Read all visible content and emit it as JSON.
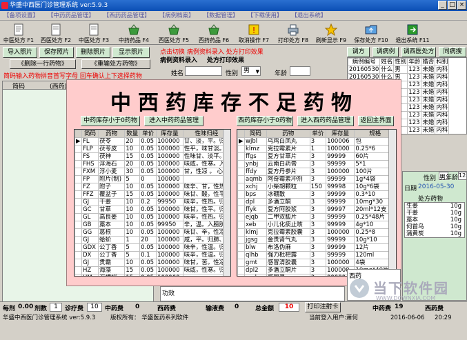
{
  "window": {
    "title": "华盛中西医门诊管理系统 ver:5.9.3"
  },
  "menu": [
    "【备项设置】",
    "【中药药品管理】",
    "【西药药品管理】",
    "【病例档案】",
    "【数据管理】",
    "【下载使用】",
    "【退出系统】"
  ],
  "toolbar": [
    {
      "label": "中医处方 F1",
      "icon": "document-icon"
    },
    {
      "label": "西医处方 F2",
      "icon": "document-icon"
    },
    {
      "label": "中医处方 F3",
      "icon": "document-icon"
    },
    {
      "label": "中药药品 F4",
      "icon": "basket-icon"
    },
    {
      "label": "西医处方 F5",
      "icon": "basket-icon"
    },
    {
      "label": "西药药品 F6",
      "icon": "basket-icon"
    },
    {
      "label": "取消操作 F7",
      "icon": "alert-icon"
    },
    {
      "label": "打印处方 F8",
      "icon": "printer-icon"
    },
    {
      "label": "刷新显示 F9",
      "icon": "star-icon"
    },
    {
      "label": "保存处方 F10",
      "icon": "folder-icon"
    },
    {
      "label": "退出系统 F11",
      "icon": "exit-icon"
    }
  ],
  "left_tabs": [
    "导入照片",
    "保存照片",
    "删除照片",
    "显示照片"
  ],
  "left_buttons": {
    "delete_row": "《删除一行药物》",
    "reimport": "《重输处方药物》"
  },
  "left_hint": "简码输入药物拼音首写字母  回车确认上下选择药物",
  "left_grid_headers": [
    "简码",
    "(西药)"
  ],
  "red_banner": "点击切换 病例资料录入 处方打印效果",
  "mid_tabs": [
    "病例资料录入",
    "处方打印效果"
  ],
  "form": {
    "name_label": "姓名",
    "name_value": "",
    "gender_label": "性别",
    "gender_value": "男",
    "age_label": "年龄",
    "age_value": ""
  },
  "right_tabs": [
    "调方",
    "调病例",
    "调西医处方",
    "同病搜"
  ],
  "right_table": {
    "headers": [
      "病例编号",
      "姓名",
      "性别",
      "年龄",
      "婚否",
      "家",
      "科别"
    ],
    "rows": [
      [
        "20160530",
        "什么",
        "男",
        "123",
        "未婚",
        "内科"
      ],
      [
        "20160530",
        "什么",
        "男",
        "123",
        "未婚",
        "内科"
      ],
      [
        "20160530",
        "什么",
        "男",
        "123",
        "未婚",
        "内科"
      ],
      [
        "20160530",
        "什么",
        "男",
        "123",
        "未婚",
        "内科"
      ],
      [
        "20160530",
        "什么",
        "男",
        "123",
        "未婚",
        "内科"
      ],
      [
        "20160530",
        "什么",
        "男",
        "123",
        "未婚",
        "内科"
      ],
      [
        "20160530",
        "什么",
        "男",
        "123",
        "未婚",
        "内科"
      ],
      [
        "20160530",
        "什么",
        "男",
        "123",
        "未婚",
        "内科"
      ],
      [
        "20160530",
        "什么",
        "男",
        "123",
        "未婚",
        "内科"
      ]
    ]
  },
  "overlay": {
    "title": "中西药库存不足药物",
    "left_btn1": "中药库存小于0药物",
    "left_btn2": "进入中药药品管理",
    "right_btn1": "西药库存小于0药物",
    "right_btn2": "进入西药药品管理",
    "right_btn3": "返回主界面",
    "left_headers": [
      "简码",
      "药物",
      "数量",
      "单价",
      "库存量",
      "性味归经"
    ],
    "left_rows": [
      [
        "FL",
        "茯苓",
        "20",
        "0.05",
        "100000",
        "甘、淡，平。归"
      ],
      [
        "FLP",
        "茯苓皮",
        "10",
        "0.05",
        "100000",
        "性平，味甘淡。"
      ],
      [
        "FS",
        "茯神",
        "15",
        "0.05",
        "100000",
        "性味甘、淡平。"
      ],
      [
        "FHS",
        "浮海石",
        "20",
        "0.05",
        "100000",
        "味咸，性寒。入"
      ],
      [
        "FXM",
        "浮小麦",
        "30",
        "0.05",
        "100000",
        "甘，性凉 。 心"
      ],
      [
        "FP",
        "附片(制)",
        "5",
        "0",
        "100000",
        ""
      ],
      [
        "FZ",
        "附子",
        "10",
        "0.05",
        "100000",
        "味辛、甘，性热"
      ],
      [
        "FFZ",
        "覆盆子",
        "15",
        "0.05",
        "100000",
        "味甘、酸，性平"
      ],
      [
        "GJ",
        "干姜",
        "10",
        "0.2",
        "99950",
        "味辛，性热。归"
      ],
      [
        "GC",
        "甘草",
        "10",
        "0.05",
        "100000",
        "味甘，性平。归"
      ],
      [
        "GL",
        "高良姜",
        "10",
        "0.05",
        "100000",
        "味辛，性热。归"
      ],
      [
        "GB",
        "藁本",
        "10",
        "0.05",
        "99950",
        "辛，温。入膀胱"
      ],
      [
        "GG",
        "葛根",
        "10",
        "0.05",
        "100000",
        "味甘、辛，性凉"
      ],
      [
        "GJ",
        "蛤蚧",
        "1",
        "20",
        "100000",
        "咸，平。归肺、"
      ],
      [
        "GDX",
        "公丁香",
        "5",
        "0.05",
        "100000",
        "味辛，性温。归"
      ],
      [
        "DX",
        "公丁香",
        "5",
        "0.1",
        "100000",
        "味辛，性温。归"
      ],
      [
        "GJ",
        "贯霸",
        "10",
        "0.05",
        "100000",
        "味甘，苦。性凉"
      ],
      [
        "HZ",
        "海藻",
        "15",
        "0.05",
        "100000",
        "味咸，性寒。归"
      ],
      [
        "HM",
        "海螵蛸",
        "15",
        "0.05",
        "100000",
        ""
      ]
    ],
    "right_headers": [
      "简码",
      "药物",
      "单价",
      "库存量",
      "规格"
    ],
    "right_rows": [
      [
        "wjbl",
        "乌鸡白凤丸",
        "3",
        "100006",
        "包"
      ],
      [
        "klmz",
        "克拉霉素片",
        "1",
        "100000",
        "0.25*6"
      ],
      [
        "ffgs",
        "复方甘草片",
        "3",
        "99999",
        "60片"
      ],
      [
        "ynbj",
        "云南白药膏",
        "3",
        "99999",
        "5*1"
      ],
      [
        "ffdy",
        "复方丹参片",
        "3",
        "100000",
        "100片"
      ],
      [
        "aqmb",
        "阿奇霉素冲剂",
        "3",
        "99999",
        "1g*4袋"
      ],
      [
        "xchj",
        "小柴胡颗粒",
        "150",
        "99998",
        "10g*6袋"
      ],
      [
        "bps",
        "冰硼散",
        "3",
        "99999",
        "0.3*10"
      ],
      [
        "dpl",
        "多潘立酮",
        "3",
        "99999",
        "10mg*30"
      ],
      [
        "ffyk",
        "复方阿胶浆",
        "3",
        "99997",
        "20ml*12支"
      ],
      [
        "ejqb",
        "二甲双胍片",
        "3",
        "99999",
        "0.25*48片"
      ],
      [
        "xeb",
        "小儿化痰止咳",
        "3",
        "99999",
        "4g*10"
      ],
      [
        "klmj",
        "克拉霉素胶囊",
        "3",
        "100000",
        "0.25*8"
      ],
      [
        "jgsg",
        "金贵肾气丸",
        "3",
        "99999",
        "10g*10"
      ],
      [
        "blw",
        "布洛伪麻",
        "3",
        "99999",
        "12片"
      ],
      [
        "qlhb",
        "强力枇杷露",
        "3",
        "99999",
        "120ml"
      ],
      [
        "gmt",
        "感冒清胶囊",
        "3",
        "100000",
        "4袋"
      ],
      [
        "dpl2",
        "多潘立酮片",
        "3",
        "100000",
        "10mg*40片"
      ],
      [
        "gml",
        "感冒灵",
        "3",
        "99999",
        "10g*9袋"
      ]
    ]
  },
  "right_lower": {
    "gender_label": "性别",
    "gender_value": "男",
    "age_label": "年龄",
    "age_value": "123",
    "date_label": "日期",
    "date_value": "2016-05-30",
    "rx_header": "处方药物",
    "rx_items": [
      "生姜",
      "干姜",
      "藁本",
      "何首乌",
      "蒲黄炭"
    ],
    "rx_qty": [
      "10g",
      "10g",
      "10g",
      "10g",
      "10g"
    ],
    "side_label": "西药",
    "side_label2": "功效"
  },
  "statusbar": {
    "per_dose_label": "每剂",
    "per_dose_value": "0.00",
    "doses_label": "剂数",
    "doses_value": "1",
    "consult_label": "诊疗费",
    "consult_value": "10",
    "west_label": "中药费",
    "west_value": "0",
    "west_drug_label": "西药费",
    "infusion_label": "输液费",
    "infusion_value": "0",
    "total_label": "总金额",
    "total_value": "10",
    "print_btn": "打印注射卡",
    "mid_fee_label": "中药费",
    "mid_fee_value": "19",
    "west_fee_label": "西药费"
  },
  "bottom": {
    "left": "华盛中西医门诊管理系统 ver:5.9.3",
    "mid": "版权所有： 华盛医药系列软件",
    "user": "当前登入用户:萧何",
    "date": "2016-06-06",
    "time": "20:29"
  },
  "watermark": {
    "text": "当下软件园",
    "sub": "WWW.DOWNXIA.COM"
  }
}
